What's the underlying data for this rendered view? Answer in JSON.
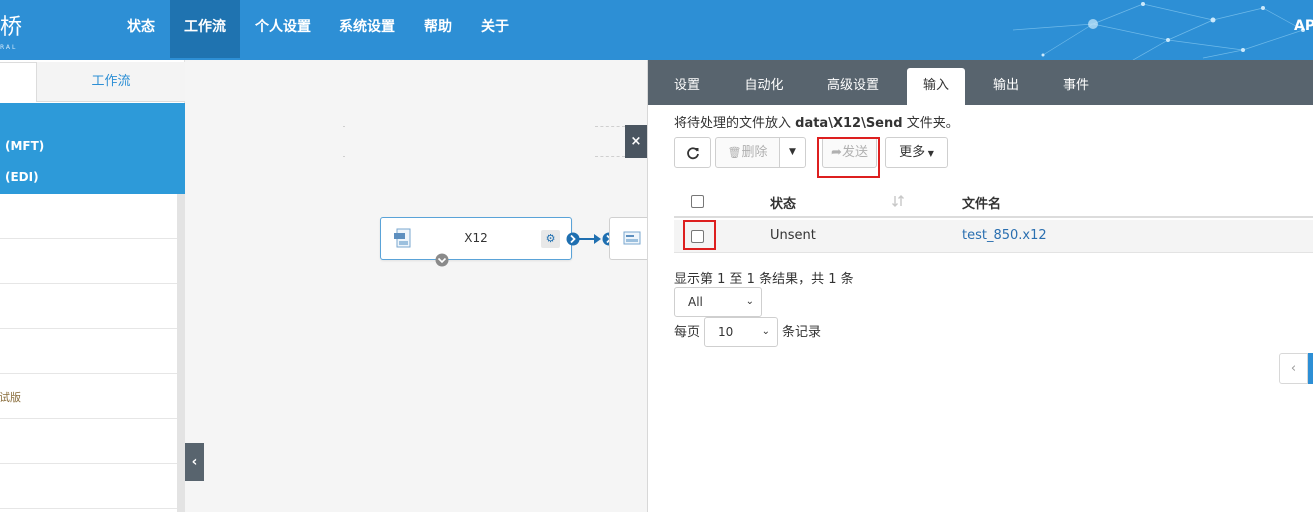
{
  "header": {
    "logo_fragment": "桥",
    "logo_sub": "RAL",
    "nav": [
      "状态",
      "工作流",
      "个人设置",
      "系统设置",
      "帮助",
      "关于"
    ],
    "active_nav": "工作流",
    "right_text": "API"
  },
  "left_panel": {
    "tab_workflow": "工作流",
    "selected_items": [
      "(MFT)",
      "(EDI)"
    ],
    "beta_fragment": "调试版"
  },
  "canvas": {
    "node_label": "X12",
    "close_symbol": "×",
    "collapse_symbol": "‹"
  },
  "right_panel": {
    "tabs": [
      "设置",
      "自动化",
      "高级设置",
      "输入",
      "输出",
      "事件"
    ],
    "active_tab": "输入",
    "hint_prefix": "将待处理的文件放入 ",
    "hint_path": "data\\X12\\Send",
    "hint_suffix": " 文件夹。",
    "toolbar": {
      "delete_label": "删除",
      "send_label": "发送",
      "more_label": "更多"
    },
    "table": {
      "headers": [
        "状态",
        "文件名"
      ],
      "rows": [
        {
          "status": "Unsent",
          "filename": "test_850.x12"
        }
      ]
    },
    "summary": "显示第 1 至 1 条结果，共 1 条",
    "filter_value": "All",
    "per_page_prefix": "每页",
    "per_page_value": "10",
    "per_page_suffix": "条记录"
  },
  "colors": {
    "primary": "#2d8fd5",
    "dark_tabbar": "#58646e",
    "highlight_box": "#dd1f1f",
    "link": "#2a6fb0"
  }
}
